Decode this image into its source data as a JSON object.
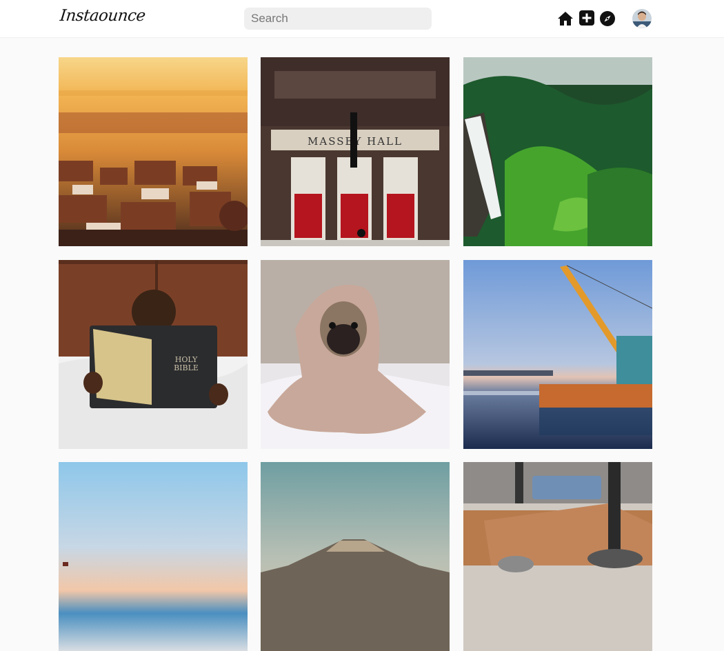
{
  "app": {
    "brand": "Instaounce"
  },
  "search": {
    "placeholder": "Search"
  },
  "nav": {
    "icons": [
      "home-icon",
      "plus-square-icon",
      "compass-icon",
      "avatar"
    ]
  },
  "feed": {
    "photos": [
      {
        "name": "photo-sunset-city",
        "subject": "sunset over city houses"
      },
      {
        "name": "photo-massey-hall",
        "subject": "Massey Hall building with red doors",
        "sign": "MASSEY HALL"
      },
      {
        "name": "photo-waterfall",
        "subject": "waterfall in green forest"
      },
      {
        "name": "photo-child-reading",
        "subject": "child reading a book",
        "book_text": "HOLY BIBLE"
      },
      {
        "name": "photo-pug-blanket",
        "subject": "pug wrapped in a blanket"
      },
      {
        "name": "photo-harbor-crane",
        "subject": "crane ship in harbor at dusk"
      },
      {
        "name": "photo-beach-sky",
        "subject": "beach under pastel sky"
      },
      {
        "name": "photo-mountain",
        "subject": "mountain in haze"
      },
      {
        "name": "photo-leather-desk",
        "subject": "leather wallet on a desk"
      }
    ]
  }
}
